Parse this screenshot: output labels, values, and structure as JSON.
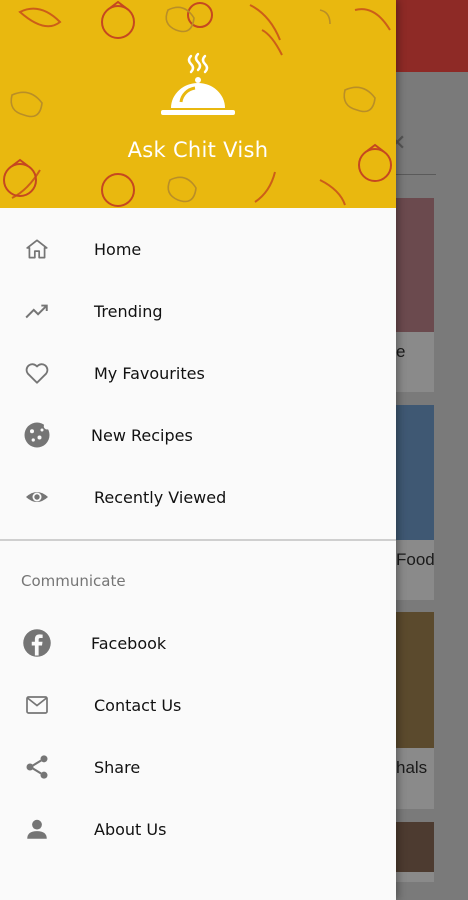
{
  "background": {
    "card_texts": [
      "e",
      "Food",
      "hals"
    ]
  },
  "drawer": {
    "app_name": "Ask Chit Vish",
    "main_menu": [
      {
        "label": "Home",
        "icon": "home-icon"
      },
      {
        "label": "Trending",
        "icon": "trending-icon"
      },
      {
        "label": "My Favourites",
        "icon": "heart-icon"
      },
      {
        "label": "New Recipes",
        "icon": "cookie-icon"
      },
      {
        "label": "Recently Viewed",
        "icon": "eye-icon"
      }
    ],
    "section_title": "Communicate",
    "communicate_menu": [
      {
        "label": "Facebook",
        "icon": "facebook-icon"
      },
      {
        "label": "Contact Us",
        "icon": "mail-icon"
      },
      {
        "label": "Share",
        "icon": "share-icon"
      },
      {
        "label": "About Us",
        "icon": "person-icon"
      }
    ]
  },
  "colors": {
    "header_yellow": "#e9b80f",
    "appbar_red": "#8e2a26",
    "icon_gray": "#757575"
  }
}
